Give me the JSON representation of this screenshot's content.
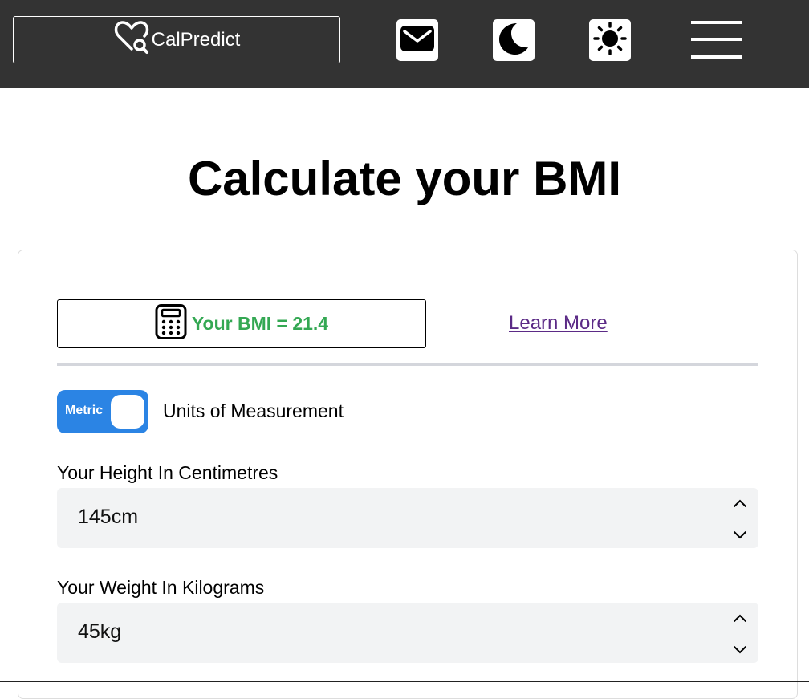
{
  "header": {
    "brand_label": "CalPredict",
    "icons": [
      "heart-search-icon",
      "mail-icon",
      "moon-icon",
      "sun-icon",
      "menu-icon"
    ]
  },
  "main": {
    "title": "Calculate your BMI"
  },
  "result": {
    "bmi_text": "Your BMI = 21.4",
    "icon": "calculator-icon",
    "learn_more_label": "Learn More"
  },
  "units": {
    "toggle_label": "Metric",
    "label": "Units of Measurement"
  },
  "height": {
    "label": "Your Height In Centimetres",
    "value": "145cm"
  },
  "weight": {
    "label": "Your Weight In Kilograms",
    "value": "45kg"
  },
  "colors": {
    "header_bg": "#333333",
    "bmi_green": "#34a853",
    "toggle_blue": "#2b84e4",
    "link_purple": "#5b2a86",
    "field_bg": "#f2f3f4"
  }
}
